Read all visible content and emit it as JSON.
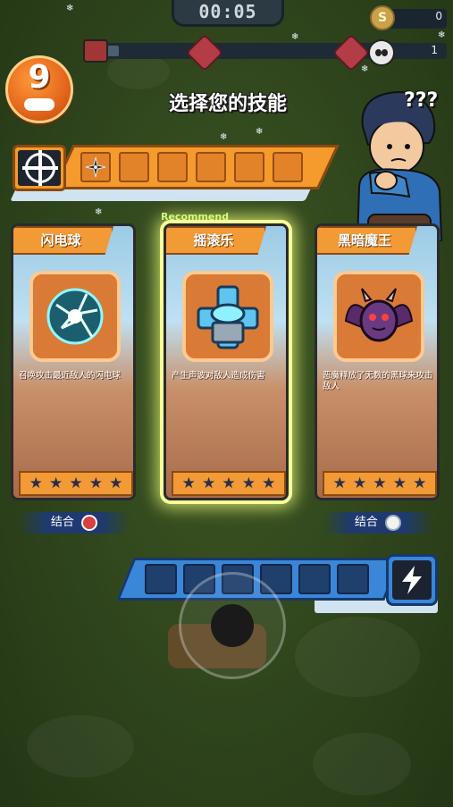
{
  "hud": {
    "timer": "00:05",
    "coin_symbol": "S",
    "coin_count": "0",
    "kill_count": "1",
    "level": "9",
    "progress": 0.04
  },
  "screen": {
    "title": "选择您的技能",
    "thinking_text": "???"
  },
  "weapon_slots": {
    "filled": [
      "shuriken"
    ],
    "total": 6
  },
  "recommend_label": "Recommend",
  "cards": [
    {
      "name": "闪电球",
      "icon": "lightning-orb-icon",
      "description": "召唤攻击最近敌人的闪电球",
      "stars": 5,
      "combine_label": "结合",
      "combine_icon": "mushroom-icon",
      "recommended": false
    },
    {
      "name": "摇滚乐",
      "icon": "speaker-tower-icon",
      "description": "产生声波对敌人造成伤害",
      "stars": 5,
      "combine_label": "",
      "combine_icon": "",
      "recommended": true
    },
    {
      "name": "黑暗魔王",
      "icon": "demon-icon",
      "description": "恶魔释放了无数的黑球来攻击敌人",
      "stars": 5,
      "combine_label": "结合",
      "combine_icon": "ghost-icon",
      "recommended": false
    }
  ],
  "energy_slots": {
    "filled": 0,
    "total": 6
  },
  "colors": {
    "card_orange": "#f29a36",
    "energy_blue": "#3a86d9",
    "recommend_glow": "#f5ff9a",
    "level_badge": "#e4661c"
  }
}
